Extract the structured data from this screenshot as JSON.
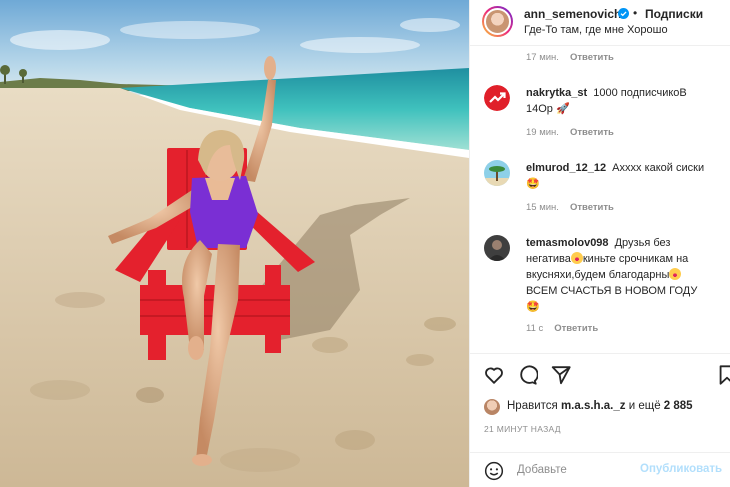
{
  "post": {
    "username": "ann_semenovich",
    "separator": "•",
    "follow_label": "Подписки",
    "location": "Где-То там, где мне Хорошо"
  },
  "top_meta": {
    "time": "17 мин.",
    "reply": "Ответить"
  },
  "comments": [
    {
      "user": "nakrytka_st",
      "text_parts": [
        "1000 подписчикоВ",
        "14Ор",
        "🚀"
      ],
      "time": "19 мин.",
      "reply": "Ответить"
    },
    {
      "user": "elmurod_12_12",
      "text": "Ахххх какой сиски",
      "emoji": "🤩",
      "time": "15 мин.",
      "reply": "Ответить"
    },
    {
      "user": "temasmolov098",
      "text_lines": [
        "Друзья без",
        "негатива",
        "киньте срочникам на",
        "вкусняхи,будем благодарны",
        "ВСЕМ СЧАСТЬЯ В НОВОМ ГОДУ"
      ],
      "emoji": "🤩",
      "time": "11 с",
      "reply": "Ответить"
    }
  ],
  "likes": {
    "prefix": "Нравится",
    "user": "m.a.s.h.a._z",
    "middle": "и ещё",
    "count": "2 885"
  },
  "posted_ago": "21 МИНУТ НАЗАД",
  "composer": {
    "placeholder": "Добавьте",
    "publish_label": "Опубликовать"
  },
  "icons": [
    "verified-badge-icon",
    "heart-icon",
    "comment-icon",
    "share-icon",
    "bookmark-icon",
    "emoji-icon",
    "trend-icon"
  ],
  "colors": {
    "accent": "#0095f6",
    "publish_disabled": "#b2dffc",
    "chair_red": "#e4212d",
    "swimsuit": "#7a2fd4"
  }
}
